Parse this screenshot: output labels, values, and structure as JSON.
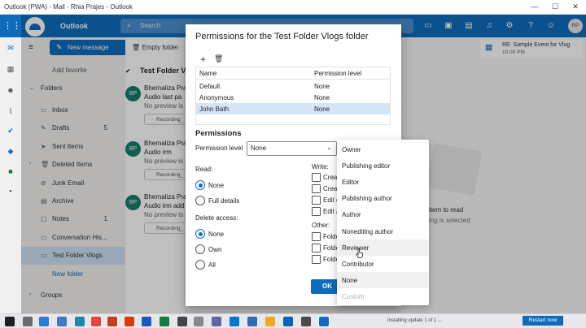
{
  "window": {
    "title": "Outlook (PWA) - Mail - Rhia Prajes - Outlook",
    "minimize": "—",
    "maximize": "☐",
    "close": "✕"
  },
  "appbar": {
    "brand": "Outlook",
    "search_placeholder": "Search",
    "avatar_initials": "RP"
  },
  "toolbar": {
    "new_message": "New message",
    "empty_folder": "Empty folder"
  },
  "nav": {
    "add_favorite": "Add favorite",
    "folders_label": "Folders",
    "groups_label": "Groups",
    "items": [
      {
        "label": "Inbox",
        "count": ""
      },
      {
        "label": "Drafts",
        "count": "5"
      },
      {
        "label": "Sent Items",
        "count": ""
      },
      {
        "label": "Deleted Items",
        "count": ""
      },
      {
        "label": "Junk Email",
        "count": ""
      },
      {
        "label": "Archive",
        "count": ""
      },
      {
        "label": "Notes",
        "count": "1"
      },
      {
        "label": "Conversation His...",
        "count": ""
      },
      {
        "label": "Test Folder Vlogs",
        "count": ""
      },
      {
        "label": "New folder",
        "count": ""
      }
    ]
  },
  "mail_list": {
    "folder_title": "Test Folder V",
    "items": [
      {
        "initials": "BP",
        "sender": "Bhernaliza Praj",
        "subject": "Audio last pa",
        "preview": "No preview is a",
        "attachment": "Recording_"
      },
      {
        "initials": "BP",
        "sender": "Bhernaliza Praj",
        "subject": "Audio irm",
        "preview": "No preview is a",
        "attachment": "Recording_"
      },
      {
        "initials": "BP",
        "sender": "Bhernaliza Praj",
        "subject": "Audio irm add",
        "preview": "No preview is a",
        "attachment": "Recording_"
      }
    ]
  },
  "reading_pane": {
    "notice_title": "RE: Sample Event for Vlog",
    "notice_time": "10:00 PM",
    "empty_title": "item to read",
    "empty_sub": "ing is selected"
  },
  "dialog": {
    "title": "Permissions for the Test Folder Vlogs folder",
    "table": {
      "headers": [
        "Name",
        "Permission level"
      ],
      "rows": [
        {
          "name": "Default",
          "level": "None"
        },
        {
          "name": "Anonymous",
          "level": "None"
        },
        {
          "name": "John Bath",
          "level": "None"
        }
      ]
    },
    "permissions_heading": "Permissions",
    "permission_level_label": "Permission level",
    "permission_level_value": "None",
    "read_label": "Read:",
    "read_options": [
      "None",
      "Full details"
    ],
    "read_selected": "None",
    "delete_label": "Delete access:",
    "delete_options": [
      "None",
      "Own",
      "All"
    ],
    "delete_selected": "None",
    "write_label": "Write:",
    "write_options": [
      "Creat",
      "Creat",
      "Edit o",
      "Edit a"
    ],
    "other_label": "Other:",
    "other_options": [
      "Folde",
      "Folde",
      "Folde"
    ],
    "ok_label": "OK"
  },
  "dropdown": {
    "options": [
      "Owner",
      "Publishing editor",
      "Editor",
      "Publishing author",
      "Author",
      "Nonediting author",
      "Reviewer",
      "Contributor",
      "None",
      "Custom"
    ],
    "hovered": "Reviewer",
    "disabled": "Custom"
  },
  "taskbar": {
    "notice": "Installing update 1 of 1 ...",
    "button": "Restart now"
  },
  "colors": {
    "accent": "#0f6cbd",
    "selected_row": "#d6e5f5",
    "nav_selected": "#cfe1f5"
  }
}
